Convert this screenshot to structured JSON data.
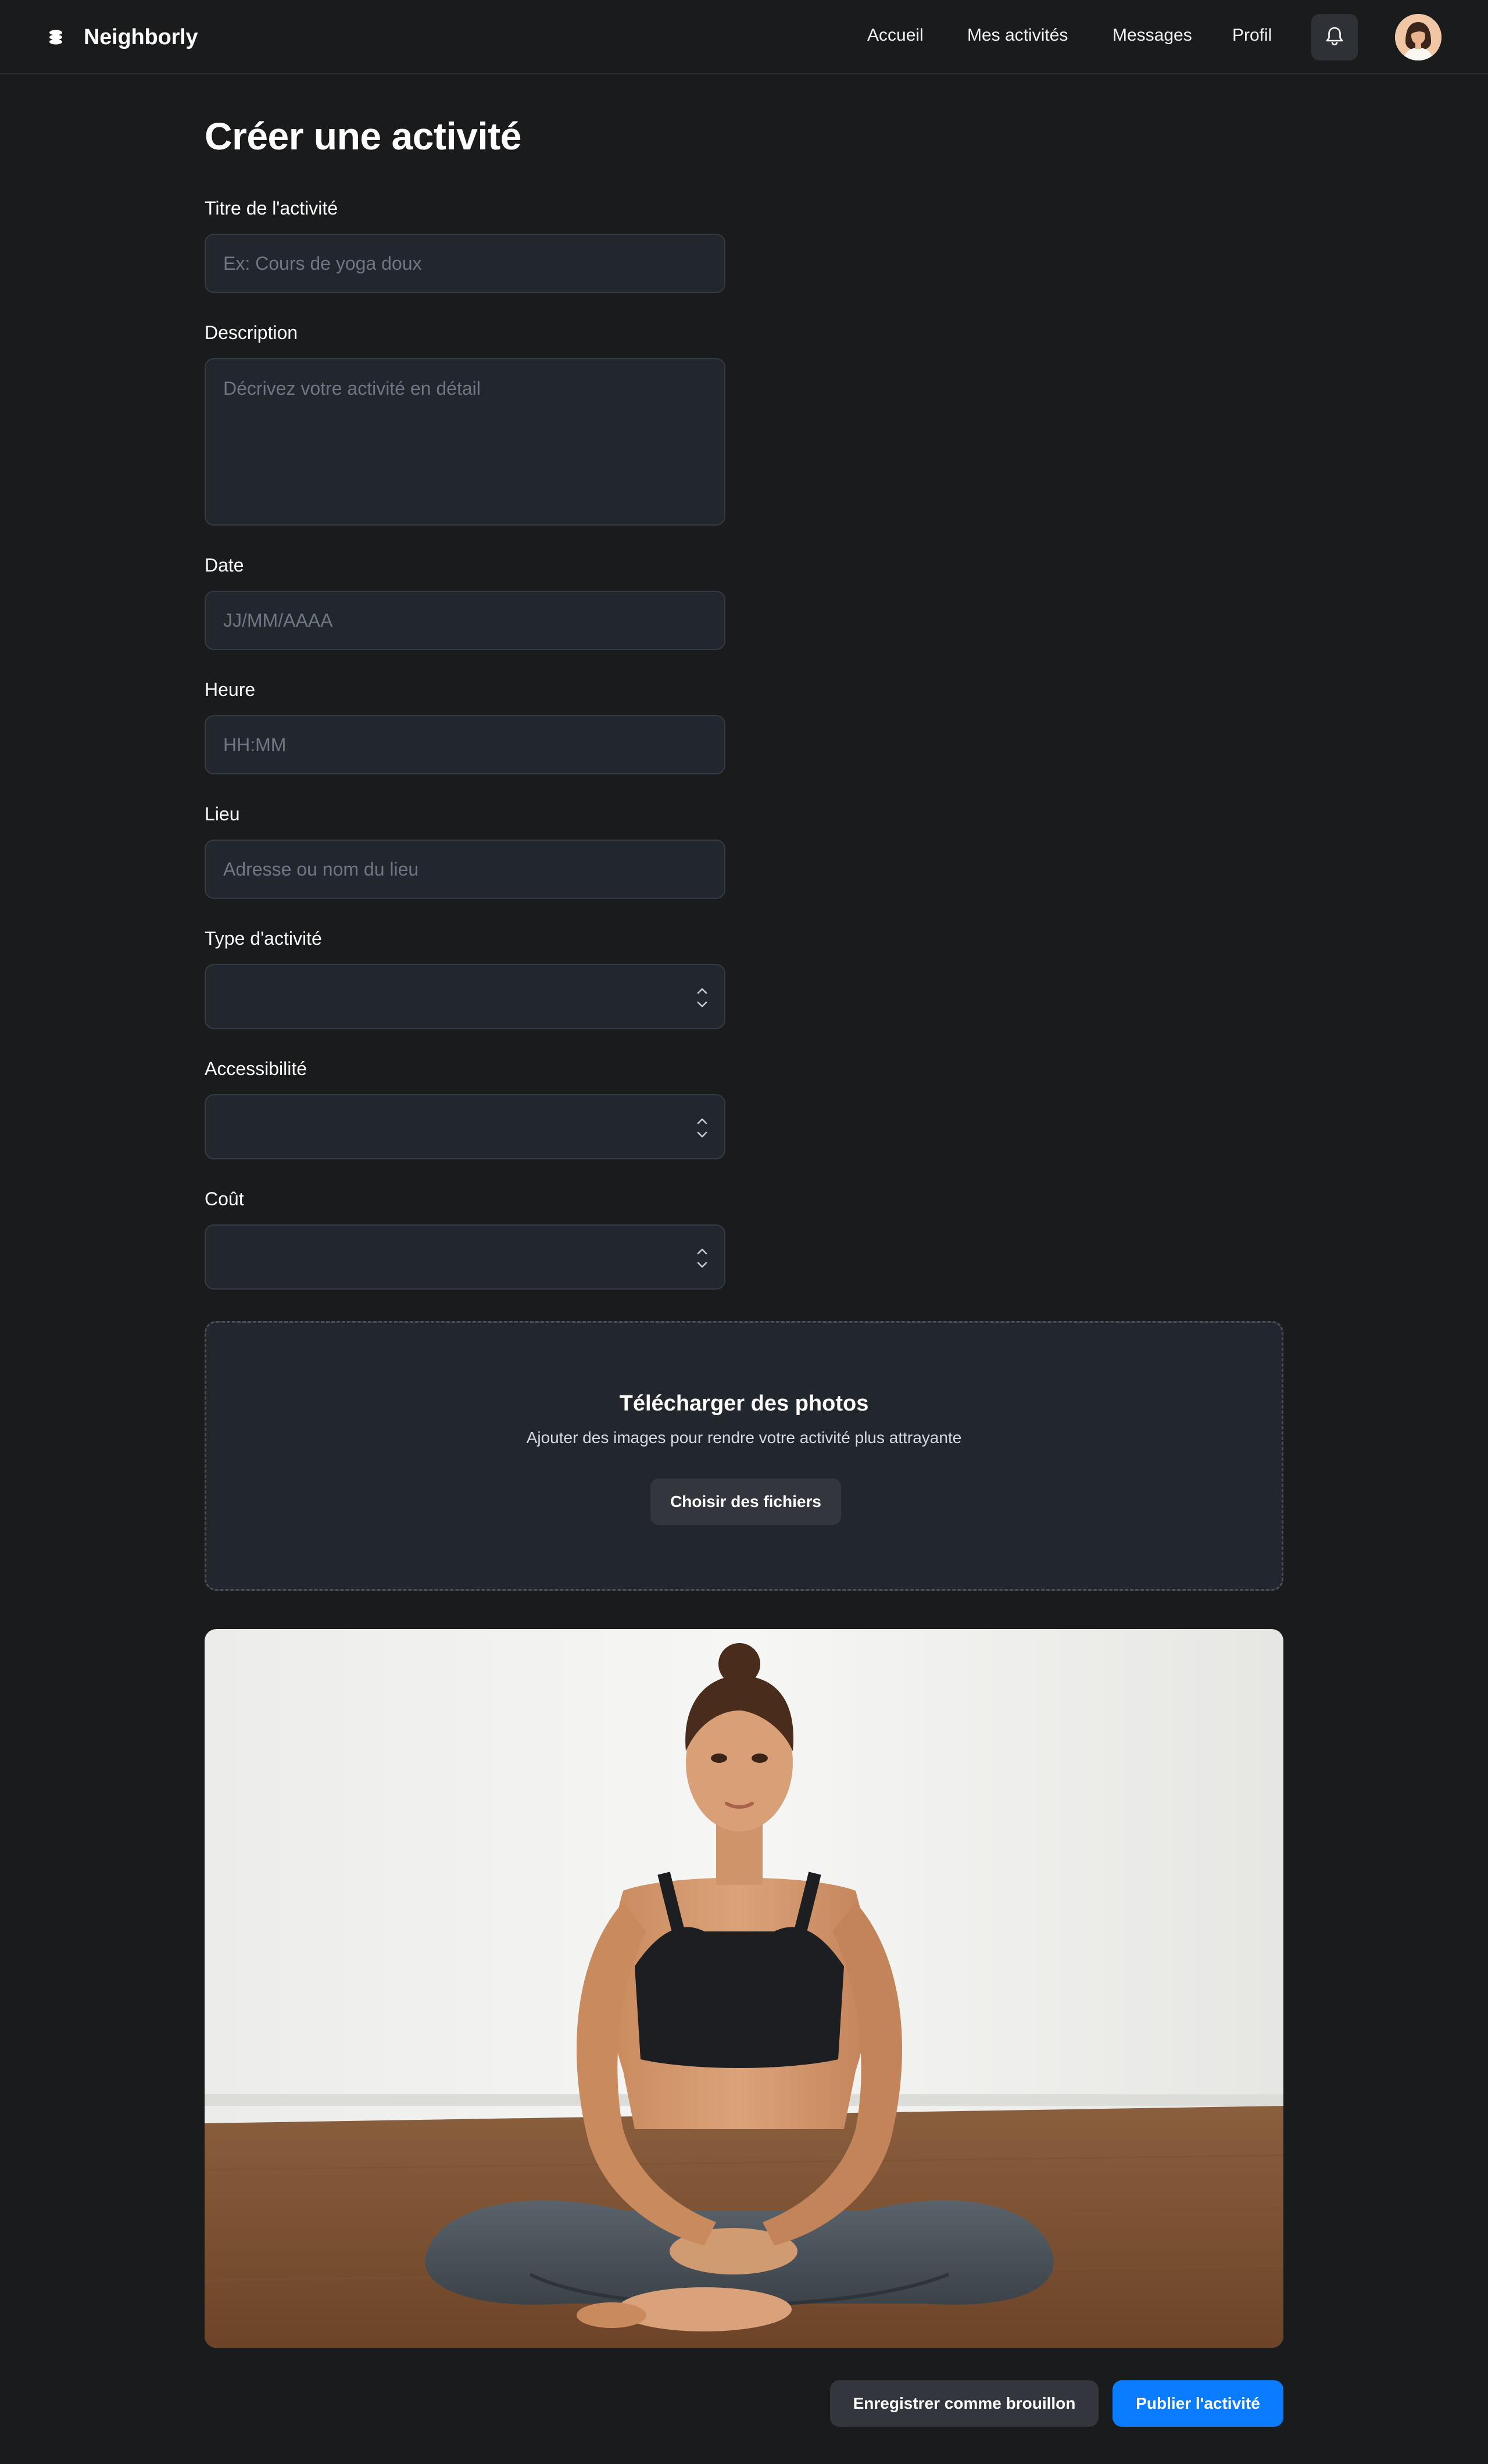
{
  "app": {
    "name": "Neighborly",
    "logo_icon": "stack-icon"
  },
  "nav": {
    "links": [
      {
        "label": "Accueil"
      },
      {
        "label": "Mes activités"
      },
      {
        "label": "Messages"
      },
      {
        "label": "Profil"
      }
    ],
    "notification_icon": "bell-icon",
    "avatar": "user-avatar"
  },
  "form": {
    "title": "Créer une activité",
    "activity_title": {
      "label": "Titre de l'activité",
      "placeholder": "Ex: Cours de yoga doux",
      "value": ""
    },
    "description": {
      "label": "Description",
      "placeholder": "Décrivez votre activité en détail",
      "value": ""
    },
    "date": {
      "label": "Date",
      "placeholder": "JJ/MM/AAAA",
      "value": ""
    },
    "time": {
      "label": "Heure",
      "placeholder": "HH:MM",
      "value": ""
    },
    "location": {
      "label": "Lieu",
      "placeholder": "Adresse ou nom du lieu",
      "value": ""
    },
    "activity_type": {
      "label": "Type d'activité",
      "value": ""
    },
    "accessibility": {
      "label": "Accessibilité",
      "value": ""
    },
    "cost": {
      "label": "Coût",
      "value": ""
    }
  },
  "upload": {
    "title": "Télécharger des photos",
    "subtitle": "Ajouter des images pour rendre votre activité plus attrayante",
    "button": "Choisir des fichiers"
  },
  "preview_photo": {
    "subject": "woman seated cross-legged in yoga pose"
  },
  "actions": {
    "save_draft": "Enregistrer comme brouillon",
    "publish": "Publier l'activité"
  },
  "colors": {
    "background": "#1a1b1c",
    "input_bg": "#22262d",
    "input_border": "#363b43",
    "secondary_button": "#33373d",
    "accent": "#0a7cff"
  }
}
